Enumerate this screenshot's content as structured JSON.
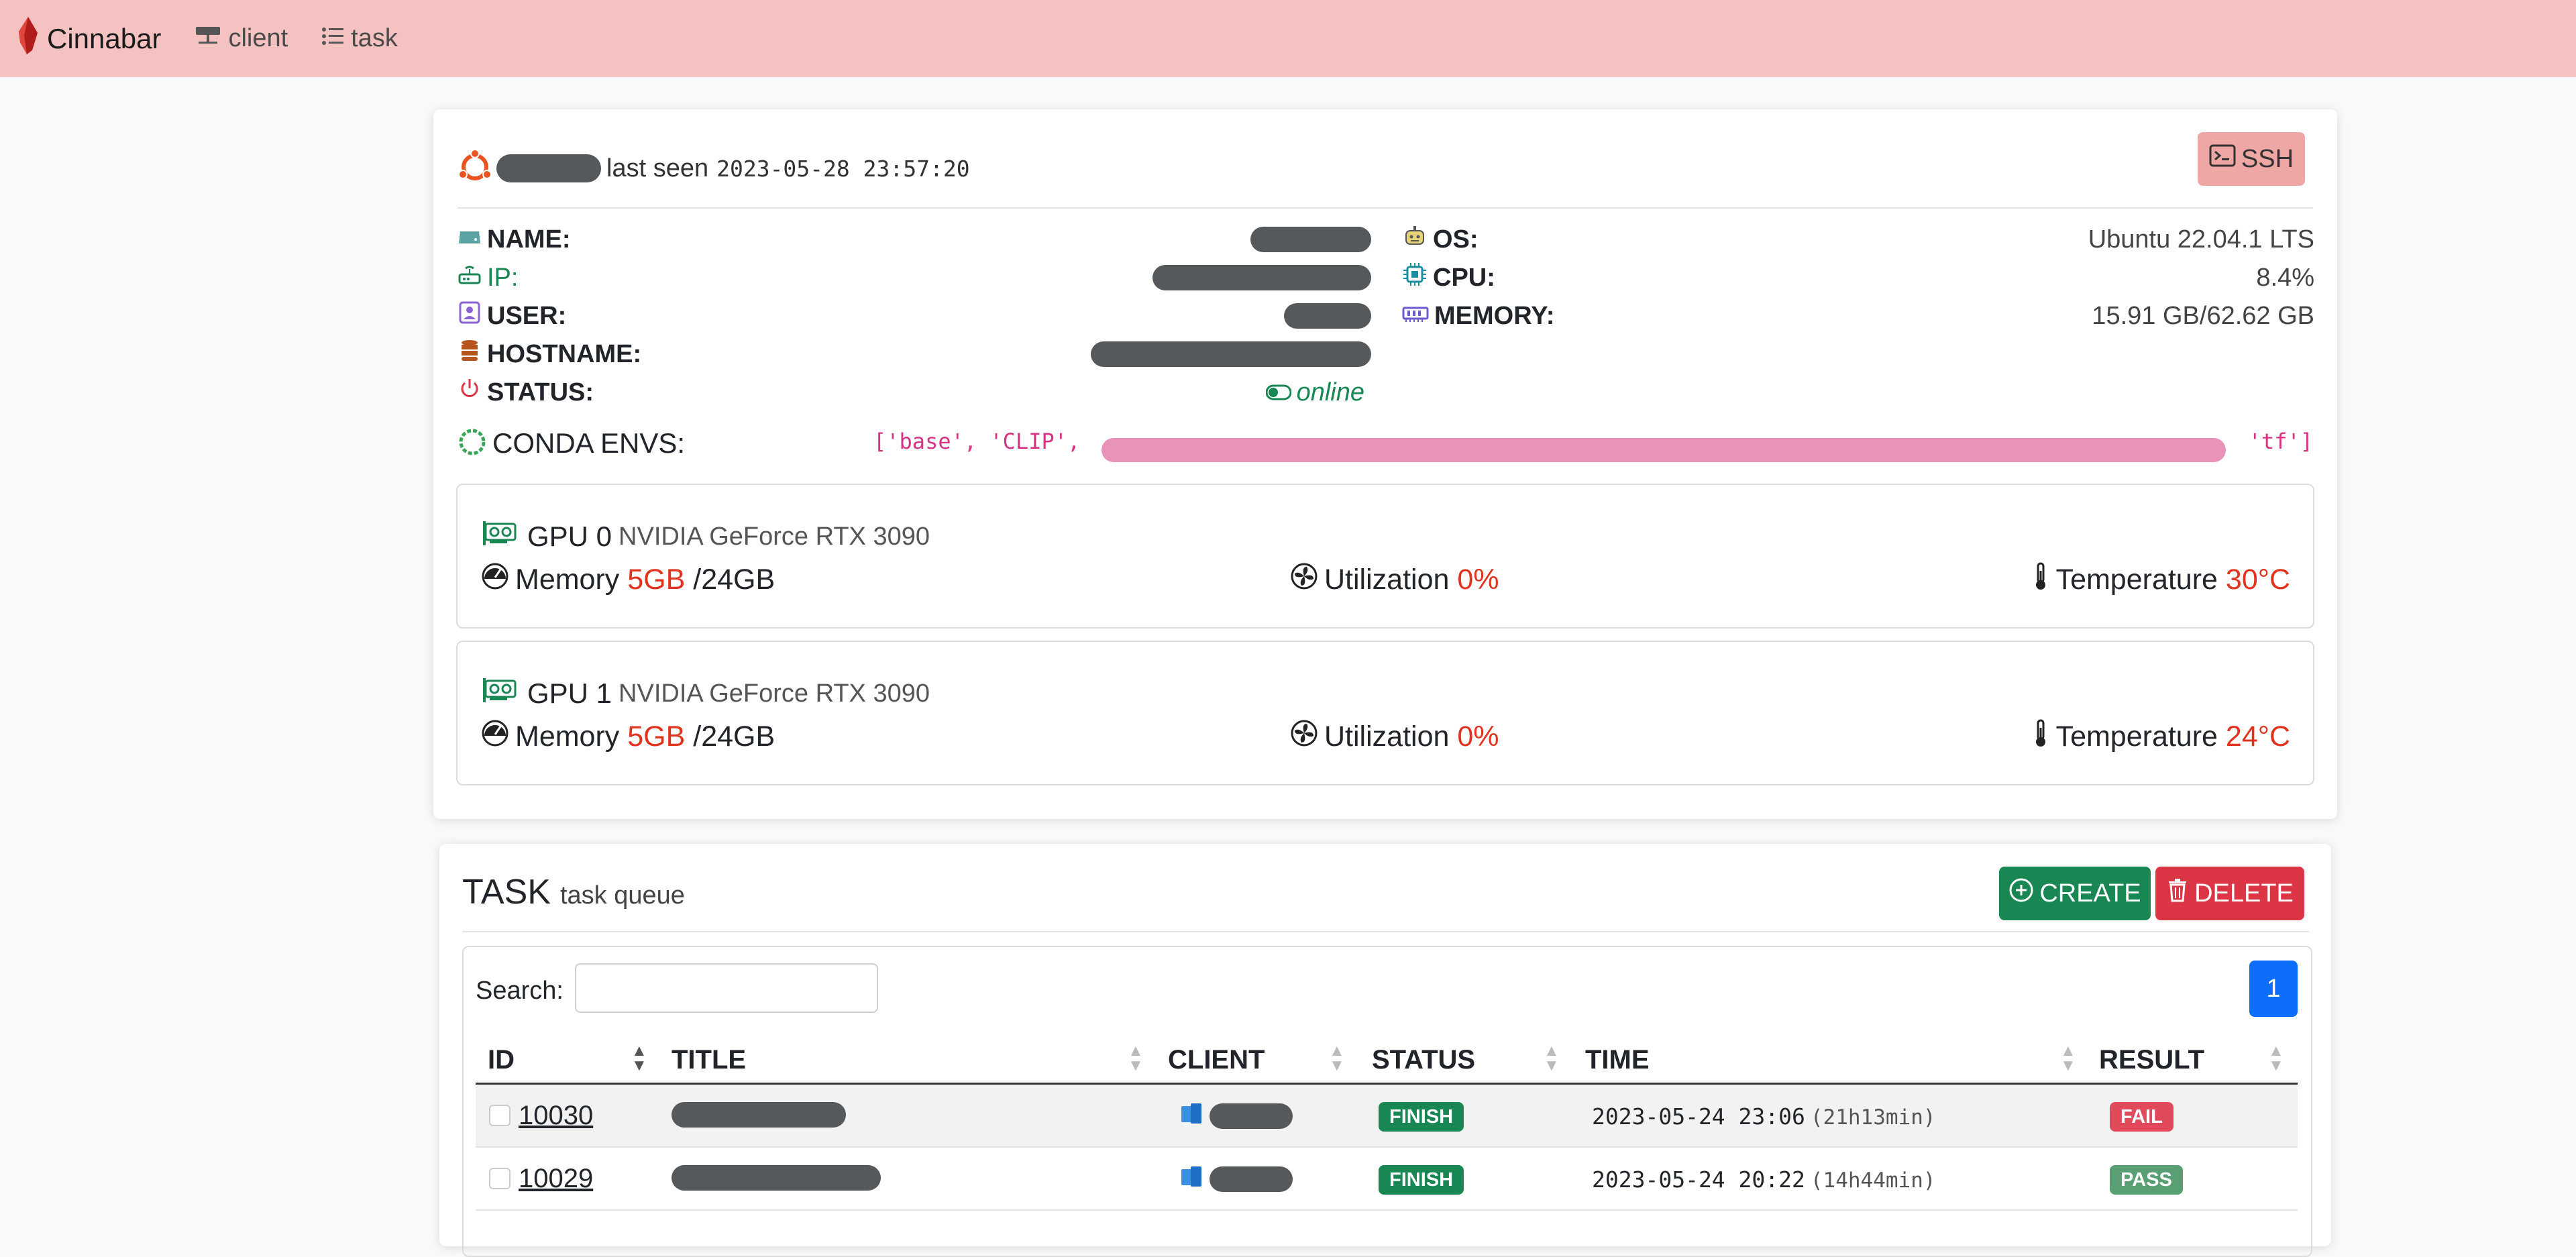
{
  "navbar": {
    "brand": "Cinnabar",
    "links": [
      {
        "label": "client",
        "icon": "server-icon"
      },
      {
        "label": "task",
        "icon": "list-icon"
      }
    ]
  },
  "client": {
    "os_icon": "ubuntu-icon",
    "last_seen_label": "last seen",
    "last_seen_time": "2023-05-28 23:57:20",
    "ssh_label": "SSH",
    "fields_left": [
      {
        "label": "NAME:",
        "icon": "hdd-icon",
        "color": "#5aa4a4"
      },
      {
        "label": "IP:",
        "icon": "router-icon",
        "color": "#198754"
      },
      {
        "label": "USER:",
        "icon": "person-badge-icon",
        "color": "#8a63d2"
      },
      {
        "label": "HOSTNAME:",
        "icon": "database-icon",
        "color": "#b5541d"
      },
      {
        "label": "STATUS:",
        "icon": "power-icon",
        "color": "#dc3545"
      }
    ],
    "status_value": "online",
    "fields_right": [
      {
        "label": "OS:",
        "value": "Ubuntu 22.04.1 LTS",
        "icon": "robot-icon"
      },
      {
        "label": "CPU:",
        "value": "8.4%",
        "icon": "cpu-icon"
      },
      {
        "label": "MEMORY:",
        "value": "15.91 GB/62.62 GB",
        "icon": "memory-icon"
      }
    ],
    "conda_label": "CONDA ENVS:",
    "conda_start": "['base', 'CLIP',",
    "conda_end": "'tf']"
  },
  "gpus": [
    {
      "title": "GPU 0",
      "model": "NVIDIA GeForce RTX 3090",
      "memory_label": "Memory",
      "memory_used": "5GB",
      "memory_total": "/24GB",
      "util_label": "Utilization",
      "util": "0%",
      "temp_label": "Temperature",
      "temp": "30°C"
    },
    {
      "title": "GPU 1",
      "model": "NVIDIA GeForce RTX 3090",
      "memory_label": "Memory",
      "memory_used": "5GB",
      "memory_total": "/24GB",
      "util_label": "Utilization",
      "util": "0%",
      "temp_label": "Temperature",
      "temp": "24°C"
    }
  ],
  "task": {
    "title": "TASK",
    "subtitle": "task queue",
    "create_label": "CREATE",
    "delete_label": "DELETE",
    "search_label": "Search:",
    "page": "1",
    "columns": [
      "ID",
      "TITLE",
      "CLIENT",
      "STATUS",
      "TIME",
      "RESULT"
    ],
    "rows": [
      {
        "id": "10030",
        "status": "FINISH",
        "time": "2023-05-24 23:06",
        "duration": "(21h13min)",
        "result": "FAIL"
      },
      {
        "id": "10029",
        "status": "FINISH",
        "time": "2023-05-24 20:22",
        "duration": "(14h44min)",
        "result": "PASS"
      }
    ]
  }
}
